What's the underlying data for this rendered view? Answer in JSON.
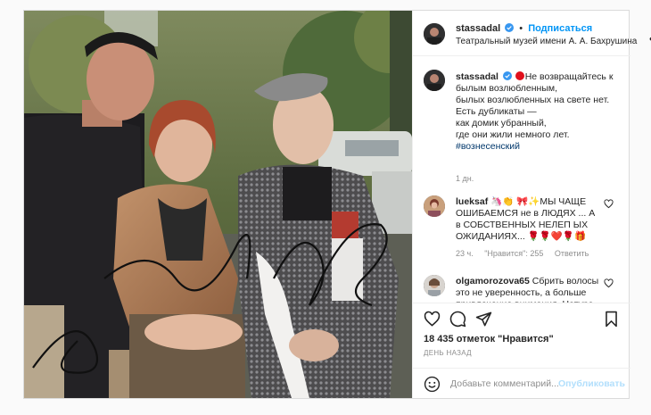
{
  "post": {
    "author": {
      "username": "stassadal",
      "verified": true,
      "follow_label": "Подписаться",
      "location": "Театральный музей имени А. А. Бахрушина",
      "more_icon": "more-horizontal-icon"
    },
    "caption": {
      "username": "stassadal",
      "badge_icon": "red-circle-emoji",
      "text": "Не возвращайтесь к\nбылым возлюбленным,\nбылых возлюбленных на свете нет.\nЕсть дубликаты —\nкак домик убранный,\nгде они жили немного лет.",
      "hashtag": "#вознесенский",
      "time": "1 дн."
    },
    "comments": [
      {
        "username": "lueksaf",
        "text": "🦄👏 🎀✨МЫ ЧАЩЕ ОШИБАЕМСЯ не в ЛЮДЯХ ... А в СОБСТВЕННЫХ НЕЛЕП ЫХ ОЖИДАНИЯХ... 🌹🌹❤️🌹🎁",
        "time": "23 ч.",
        "likes": "\"Нравится\": 255",
        "reply": "Ответить"
      },
      {
        "username": "olgamorozova65",
        "text": "Сбрить волосы это не уверенность, а больше привлечение внимания. Натура",
        "time": "",
        "likes": "",
        "reply": ""
      }
    ],
    "actions": {
      "like_icon": "heart-icon",
      "comment_icon": "comment-icon",
      "share_icon": "send-icon",
      "save_icon": "bookmark-icon"
    },
    "likes": "18 435 отметок \"Нравится\"",
    "date": "ДЕНЬ НАЗАД",
    "add_comment": {
      "placeholder": "Добавьте комментарий...",
      "publish_label": "Опубликовать",
      "emoji_icon": "smiley-icon"
    }
  },
  "colors": {
    "link_blue": "#0095f6",
    "publish_disabled": "#b2dffc",
    "hashtag": "#00376b",
    "muted": "#8e8e8e",
    "border": "#dbdbdb"
  }
}
